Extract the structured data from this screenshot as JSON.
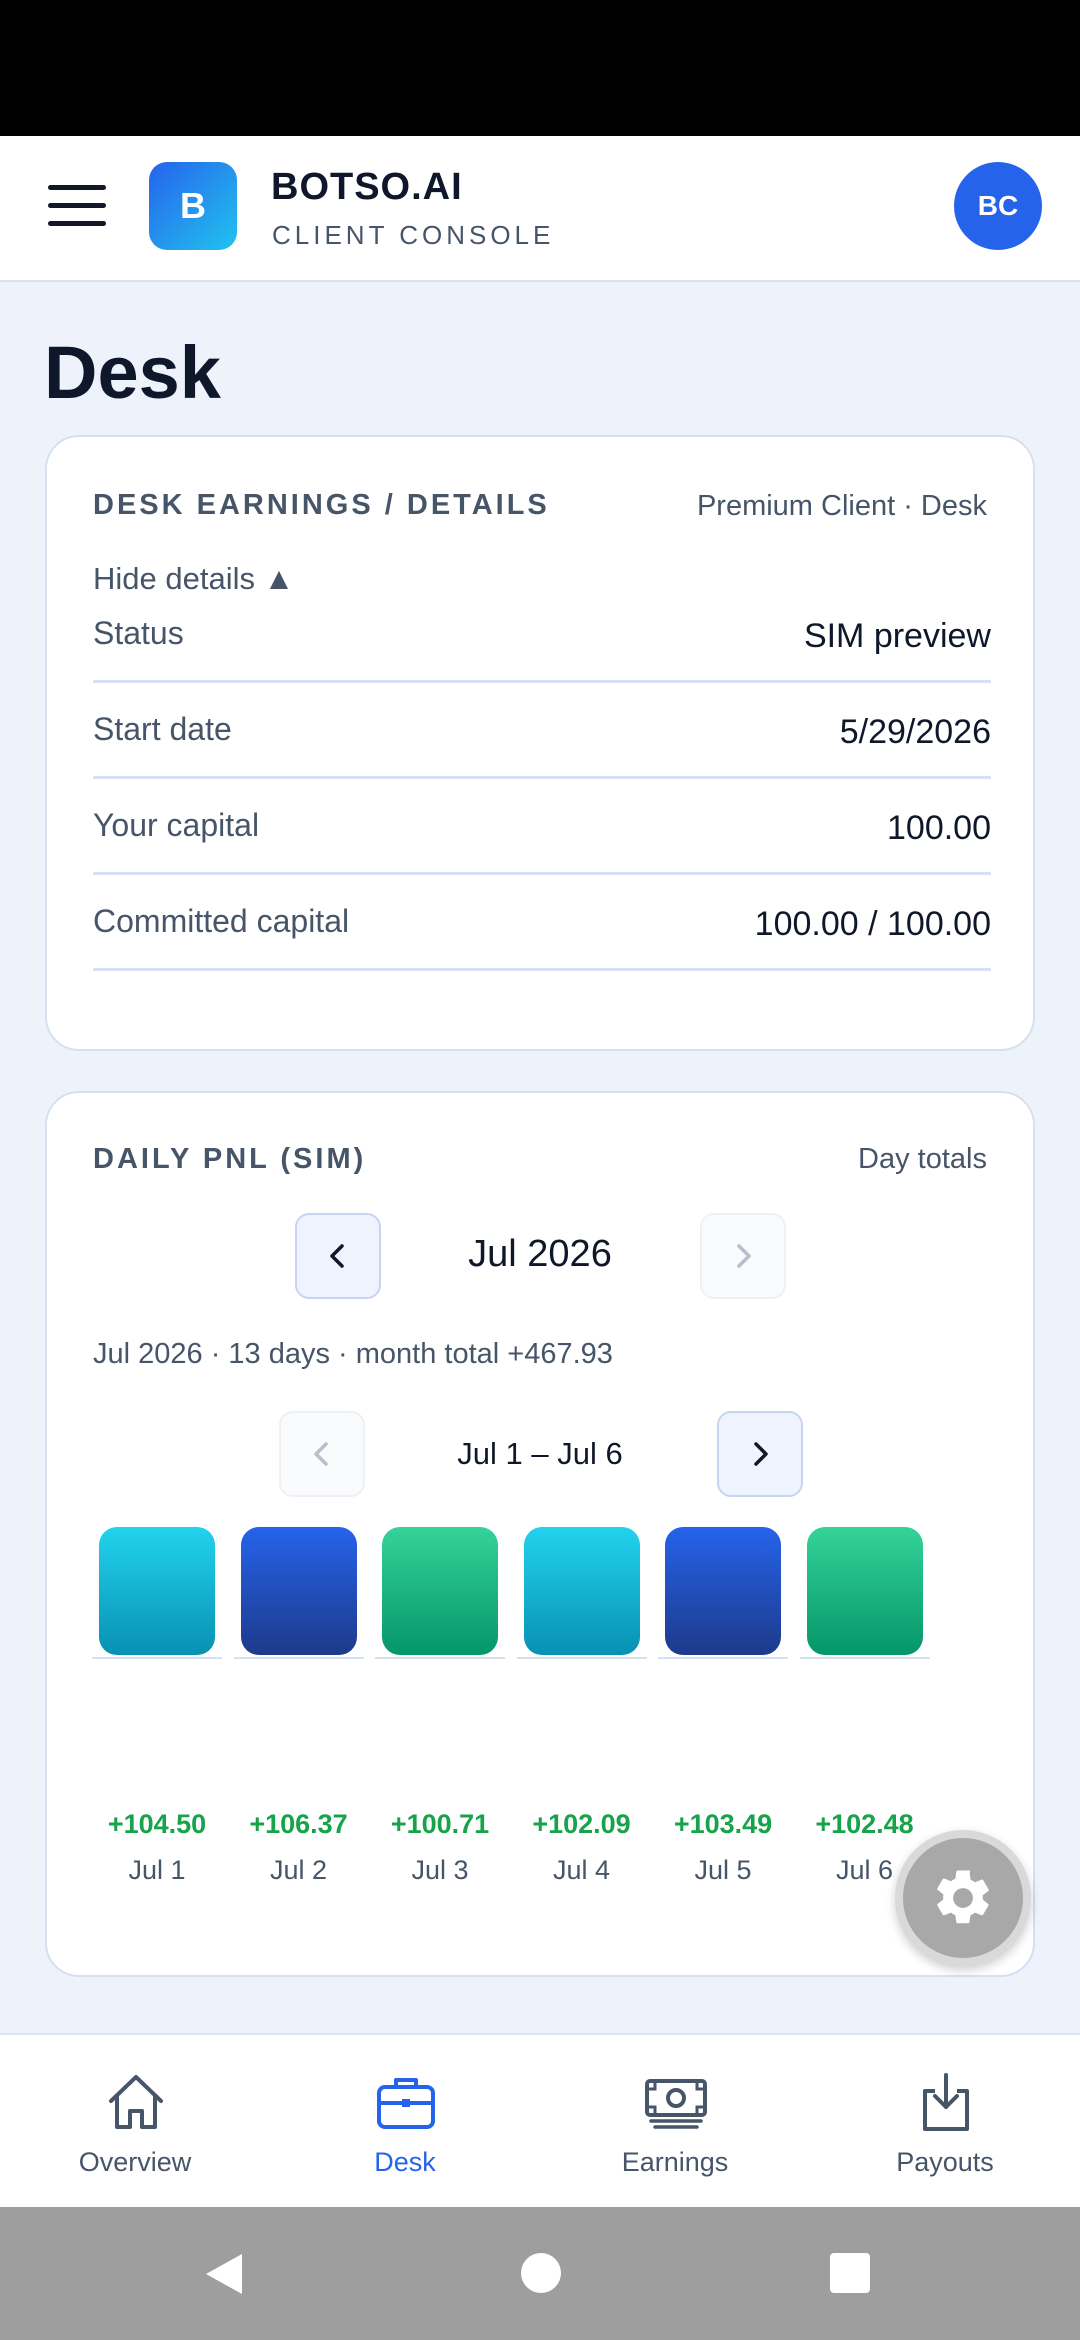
{
  "header": {
    "logo_letter": "B",
    "brand": "BOTSO.AI",
    "subtitle": "CLIENT CONSOLE",
    "avatar_initials": "BC"
  },
  "page_title": "Desk",
  "details_card": {
    "title": "DESK EARNINGS / DETAILS",
    "meta": "Premium Client · Desk",
    "toggle_label": "Hide details ▲",
    "rows": [
      {
        "label": "Status",
        "value": "SIM preview"
      },
      {
        "label": "Start date",
        "value": "5/29/2026"
      },
      {
        "label": "Your capital",
        "value": "100.00"
      },
      {
        "label": "Committed capital",
        "value": "100.00 / 100.00"
      }
    ]
  },
  "pnl_card": {
    "title": "DAILY PNL (SIM)",
    "meta": "Day totals",
    "month": "Jul 2026",
    "month_summary": "Jul 2026 · 13 days · month total +467.93",
    "week": "Jul 1 – Jul 6"
  },
  "chart_data": {
    "type": "bar",
    "categories": [
      "Jul 1",
      "Jul 2",
      "Jul 3",
      "Jul 4",
      "Jul 5",
      "Jul 6"
    ],
    "values": [
      104.5,
      106.37,
      100.71,
      102.09,
      103.49,
      102.48
    ],
    "value_labels": [
      "+104.50",
      "+106.37",
      "+100.71",
      "+102.09",
      "+103.49",
      "+102.48"
    ],
    "bar_colors": [
      "cyan",
      "blue",
      "green",
      "cyan",
      "blue",
      "green"
    ]
  },
  "bottom_nav": {
    "active": "Desk",
    "tabs": [
      {
        "label": "Overview",
        "icon": "home-icon"
      },
      {
        "label": "Desk",
        "icon": "briefcase-icon"
      },
      {
        "label": "Earnings",
        "icon": "cash-icon"
      },
      {
        "label": "Payouts",
        "icon": "download-icon"
      }
    ]
  },
  "colors": {
    "accent": "#2563eb",
    "positive": "#16a34a",
    "muted": "#475569",
    "background": "#eef3fb"
  }
}
